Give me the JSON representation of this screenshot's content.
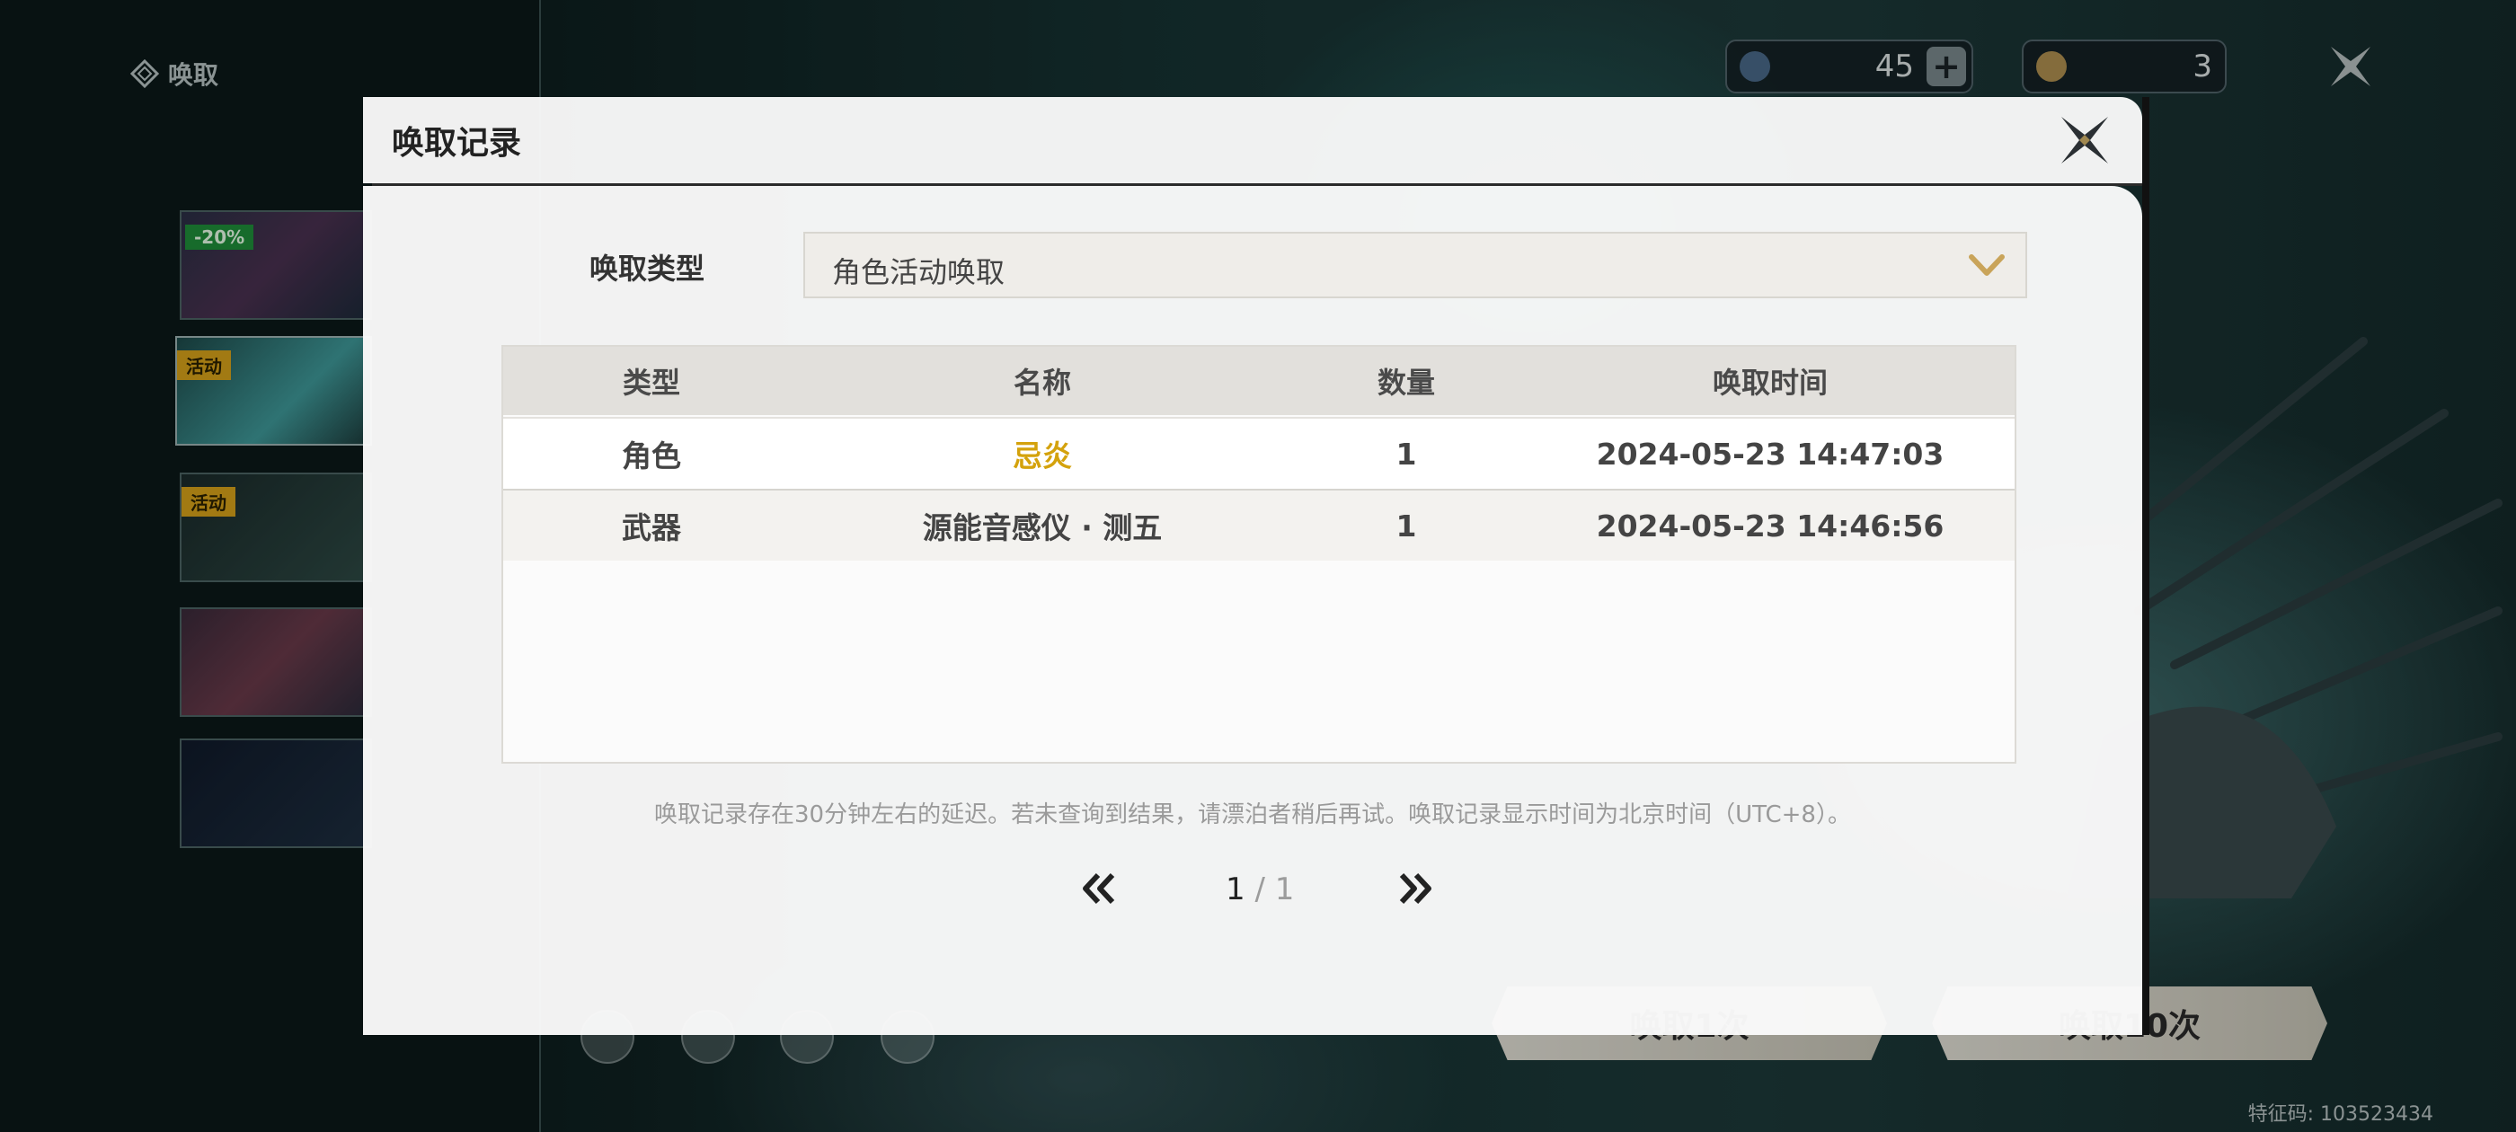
{
  "background": {
    "nav_title": "唤取",
    "banners": [
      {
        "tag": "-20%",
        "tag_kind": "discount"
      },
      {
        "tag": "活动",
        "tag_kind": "event",
        "selected": true
      },
      {
        "tag": "活动",
        "tag_kind": "event"
      },
      {
        "tag": ""
      },
      {
        "tag": ""
      }
    ],
    "currency": [
      {
        "icon": "star-tide-icon",
        "value": "45",
        "has_plus": true
      },
      {
        "icon": "coin-icon",
        "value": "3",
        "has_plus": false
      }
    ],
    "pull_once": "唤取1次",
    "pull_ten": "唤取10次",
    "feature_code": "特征码: 103523434",
    "bottom_icons": [
      "shop-icon",
      "detail-icon",
      "info-icon",
      "history-icon"
    ]
  },
  "modal": {
    "title": "唤取记录",
    "type_label": "唤取类型",
    "type_value": "角色活动唤取",
    "columns": [
      "类型",
      "名称",
      "数量",
      "唤取时间"
    ],
    "rows": [
      {
        "type": "角色",
        "name": "忌炎",
        "qty": "1",
        "time": "2024-05-23 14:47:03",
        "highlight": true
      },
      {
        "type": "武器",
        "name": "源能音感仪 · 测五",
        "qty": "1",
        "time": "2024-05-23 14:46:56",
        "highlight": false
      }
    ],
    "note": "唤取记录存在30分钟左右的延迟。若未查询到结果，请漂泊者稍后再试。唤取记录显示时间为北京时间（UTC+8）。",
    "page_current": "1",
    "page_total": "/ 1"
  },
  "colors": {
    "accent_gold": "#d4a20c",
    "select_chevron": "#c9a45a"
  }
}
